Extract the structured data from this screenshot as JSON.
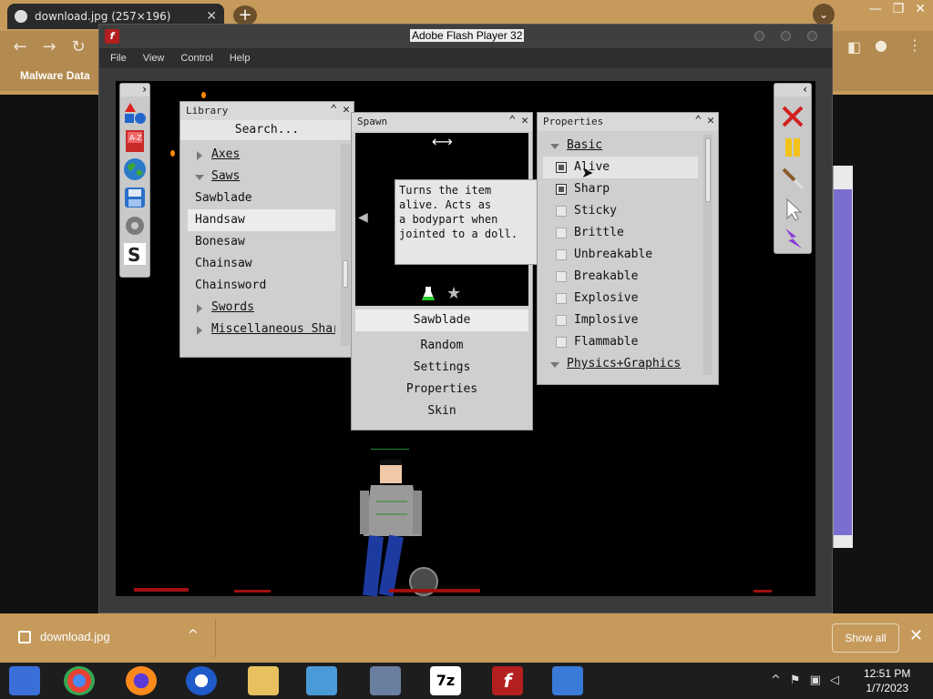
{
  "browser": {
    "tab_title": "download.jpg (257×196)",
    "new_tab": "+",
    "tab_close": "✕",
    "bookmark": "Malware Data",
    "window_controls": [
      "—",
      "❐",
      "✕"
    ]
  },
  "flash": {
    "title": "Adobe Flash Player 32",
    "logo": "f",
    "menu": [
      "File",
      "View",
      "Control",
      "Help"
    ]
  },
  "library": {
    "title": "Library",
    "search": "Search...",
    "items": [
      {
        "label": "Axes",
        "type": "folder",
        "open": false
      },
      {
        "label": "Saws",
        "type": "folder",
        "open": true
      },
      {
        "label": "Sawblade",
        "type": "item"
      },
      {
        "label": "Handsaw",
        "type": "item",
        "selected": true
      },
      {
        "label": "Bonesaw",
        "type": "item"
      },
      {
        "label": "Chainsaw",
        "type": "item"
      },
      {
        "label": "Chainsword",
        "type": "item"
      },
      {
        "label": "Swords",
        "type": "folder",
        "open": false
      },
      {
        "label": "Miscellaneous Sharp",
        "type": "folder",
        "open": false
      }
    ]
  },
  "spawn": {
    "title": "Spawn",
    "arrow": "⟷",
    "tooltip": "Turns the item\nalive. Acts as\na bodypart when\njointed to a doll.",
    "items": [
      "Sawblade",
      "Random",
      "Settings",
      "Properties",
      "Skin"
    ],
    "selected": "Sawblade"
  },
  "properties": {
    "title": "Properties",
    "group_basic": "Basic",
    "rows": [
      {
        "label": "Alive",
        "checked": true
      },
      {
        "label": "Sharp",
        "checked": true
      },
      {
        "label": "Sticky",
        "checked": false
      },
      {
        "label": "Brittle",
        "checked": false
      },
      {
        "label": "Unbreakable",
        "checked": false
      },
      {
        "label": "Breakable",
        "checked": false
      },
      {
        "label": "Explosive",
        "checked": false
      },
      {
        "label": "Implosive",
        "checked": false
      },
      {
        "label": "Flammable",
        "checked": false
      }
    ],
    "group_physics": "Physics+Graphics"
  },
  "downloads": {
    "file": "download.jpg",
    "show_all": "Show all"
  },
  "taskbar": {
    "time": "12:51 PM",
    "date": "1/7/2023"
  },
  "colors": {
    "chrome_theme": "#c59a5b",
    "panel_bg": "#cfcfcf",
    "game_bg": "#000000",
    "delete_red": "#d02020",
    "pause_yellow": "#f2c21a"
  }
}
